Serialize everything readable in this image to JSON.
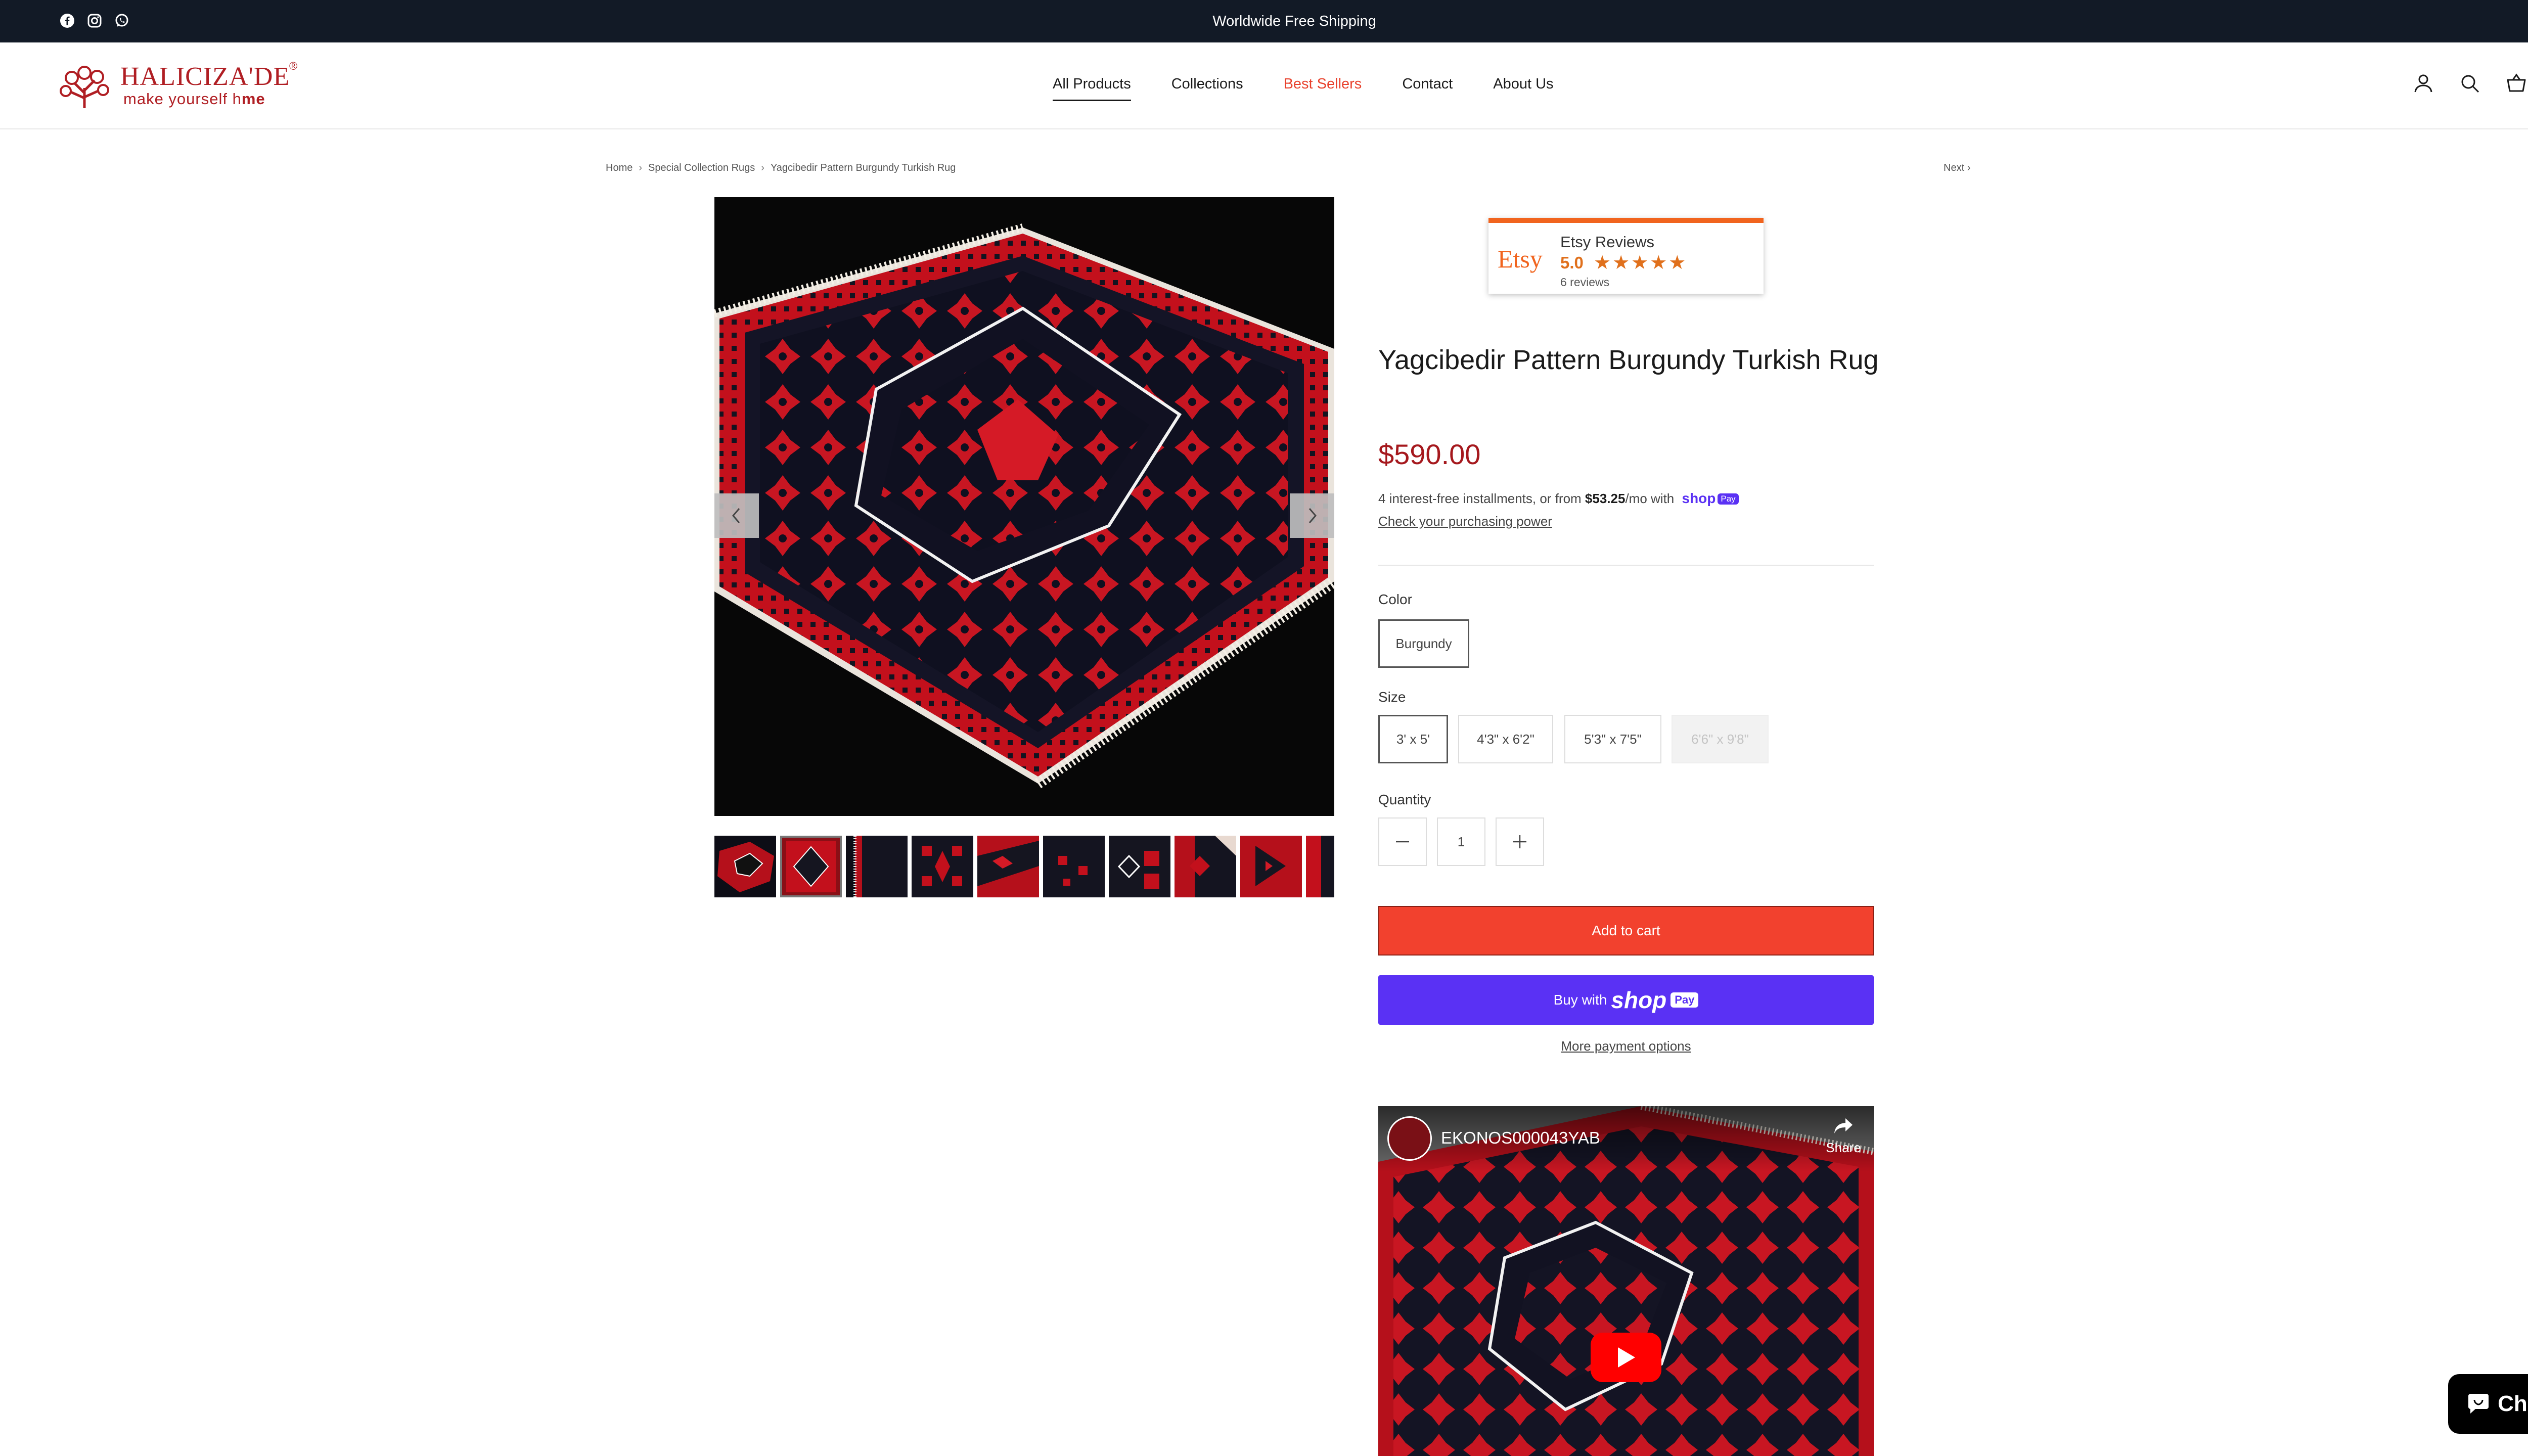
{
  "announcement": {
    "message": "Worldwide Free Shipping",
    "social_icons": [
      "facebook-icon",
      "instagram-icon",
      "whatsapp-icon"
    ]
  },
  "header": {
    "logo_name": "HALICIZA",
    "logo_name_suffix": "'DE",
    "logo_tagline": "make yourself h",
    "logo_tagline_suffix": "me",
    "logo_reg": "®",
    "nav": [
      "All Products",
      "Collections",
      "Best Sellers",
      "Contact",
      "About Us"
    ],
    "active_nav": "All Products",
    "highlight_nav": "Best Sellers",
    "icons": [
      "account-icon",
      "search-icon",
      "cart-icon"
    ]
  },
  "breadcrumb": {
    "items": [
      "Home",
      "Special Collection Rugs",
      "Yagcibedir Pattern Burgundy Turkish Rug"
    ],
    "next_label": "Next"
  },
  "gallery": {
    "thumbnail_count": 10,
    "selected_thumbnail": 2
  },
  "etsy_badge": {
    "mark": "Etsy",
    "title": "Etsy Reviews",
    "score": "5.0",
    "stars": "★★★★★",
    "count": "6 reviews"
  },
  "product": {
    "title": "Yagcibedir Pattern Burgundy Turkish Rug",
    "price": "$590.00",
    "installments_prefix": "4 interest-free installments, or from ",
    "installments_amount": "$53.25",
    "installments_suffix": "/mo with",
    "shop_logo": "shop",
    "pay_badge": "Pay",
    "check_power": "Check your purchasing power",
    "color_label": "Color",
    "colors": [
      "Burgundy"
    ],
    "selected_color": "Burgundy",
    "size_label": "Size",
    "sizes": [
      "3' x 5'",
      "4'3\" x 6'2\"",
      "5'3\" x 7'5\"",
      "6'6\" x 9'8\""
    ],
    "selected_size": "3' x 5'",
    "unavailable_size": "6'6\" x 9'8\"",
    "quantity_label": "Quantity",
    "quantity": "1",
    "minus": "−",
    "plus": "+",
    "add_to_cart": "Add to cart",
    "buy_with": "Buy with",
    "shop_word": "shop",
    "pay_word": "Pay",
    "more_payment": "More payment options"
  },
  "video": {
    "title": "EKONOS000043YAB",
    "share": "Share"
  },
  "chat": {
    "label": "Chat"
  },
  "colors": {
    "accent_red": "#f2412e",
    "price_red": "#a5181d",
    "shop_purple": "#5a31f4",
    "etsy_orange": "#f1641e",
    "topbar": "#121a26"
  }
}
